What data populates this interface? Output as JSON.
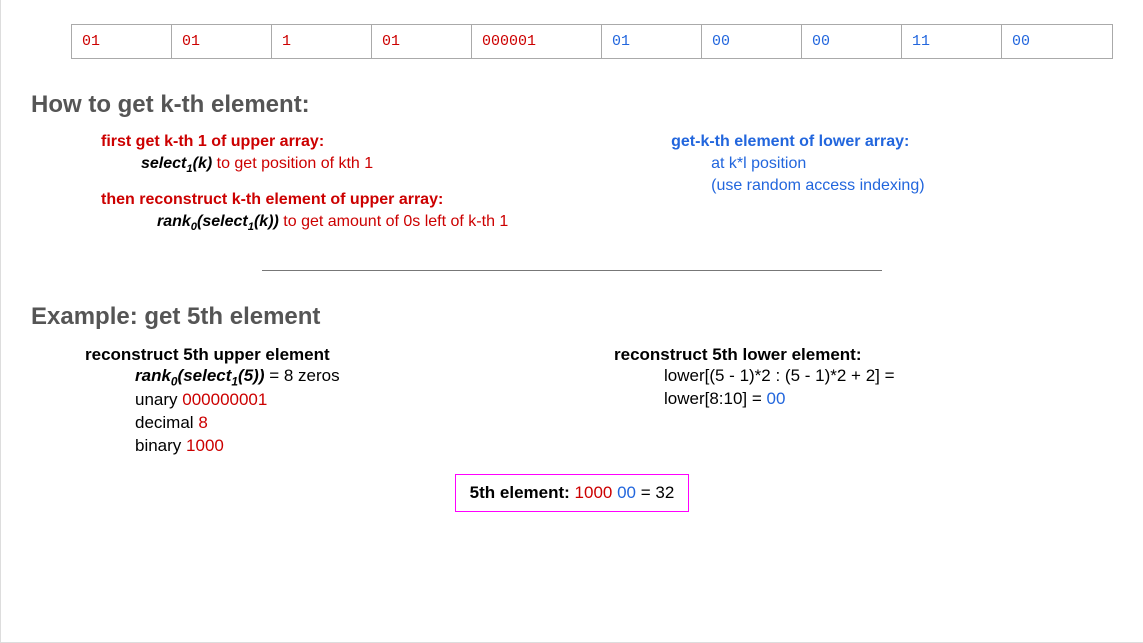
{
  "array": {
    "red_cells": [
      "01",
      "01",
      "1",
      "01",
      "000001"
    ],
    "blue_cells": [
      "01",
      "00",
      "00",
      "11",
      "00"
    ]
  },
  "heading1": "How to get k-th element:",
  "upper_method": {
    "step1_head": "first get k-th 1 of upper array:",
    "step1_func": "select",
    "step1_sub": "1",
    "step1_arg": "(k)",
    "step1_tail": " to get position of kth 1",
    "step2_head": "then reconstruct k-th element of upper array:",
    "step2_func1": "rank",
    "step2_sub1": "0",
    "step2_func2": "(select",
    "step2_sub2": "1",
    "step2_arg2": "(k))",
    "step2_tail": " to get amount of 0s left of k-th 1"
  },
  "lower_method": {
    "head": "get-k-th element of lower array:",
    "line1": "at k*l position",
    "line2": "(use random access indexing)"
  },
  "heading2": "Example: get 5th element",
  "example": {
    "upper_head": "reconstruct 5th upper element",
    "upper_func1": "rank",
    "upper_sub1": "0",
    "upper_func2": "(select",
    "upper_sub2": "1",
    "upper_arg": "(5))",
    "upper_eq": " = 8 zeros",
    "unary_label": "unary ",
    "unary_val": "000000001",
    "decimal_label": "decimal ",
    "decimal_val": "8",
    "binary_label": "binary ",
    "binary_val": "1000",
    "lower_head": "reconstruct 5th lower element:",
    "lower_line1": "lower[(5 - 1)*2 : (5 - 1)*2 + 2] =",
    "lower_line2a": "lower[8:10] = ",
    "lower_line2b": "00"
  },
  "result": {
    "label": "5th element: ",
    "red": "1000",
    "blue": "00",
    "tail": " = 32"
  }
}
